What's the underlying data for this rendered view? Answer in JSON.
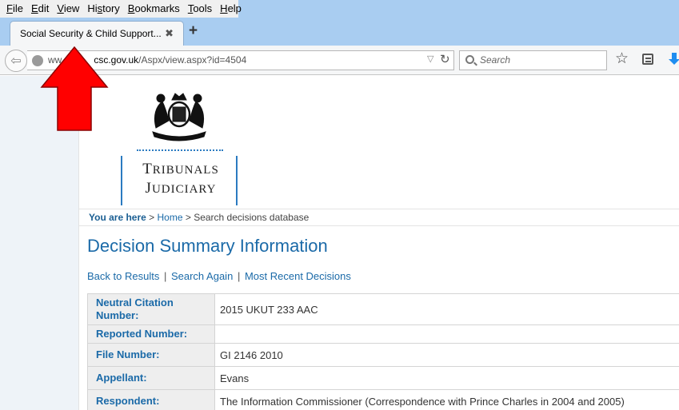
{
  "menu": {
    "items": [
      {
        "key": "F",
        "rest": "ile"
      },
      {
        "key": "E",
        "rest": "dit"
      },
      {
        "key": "V",
        "rest": "iew"
      },
      {
        "key": "",
        "pre": "Hi",
        "key2": "s",
        "post": "tory"
      },
      {
        "key": "B",
        "rest": "ookmarks"
      },
      {
        "key": "T",
        "rest": "ools"
      },
      {
        "key": "H",
        "rest": "elp"
      }
    ]
  },
  "tab": {
    "title": "Social Security & Child Support...",
    "close_glyph": "✖",
    "newtab_glyph": "+"
  },
  "navbar": {
    "url_prefix": "ww",
    "url_domain": "csc.gov.uk",
    "url_path": "/Aspx/view.aspx?id=4504",
    "search_placeholder": "Search"
  },
  "logo": {
    "line1_cap": "T",
    "line1_rest": "RIBUNALS",
    "line2_cap": "J",
    "line2_rest": "UDICIARY"
  },
  "breadcrumb": {
    "label": "You are here",
    "sep": " > ",
    "home": "Home",
    "current": "Search decisions database"
  },
  "page": {
    "heading": "Decision Summary Information",
    "links": [
      "Back to Results",
      "Search Again",
      "Most Recent Decisions"
    ],
    "link_sep": "|"
  },
  "details": [
    {
      "label": "Neutral Citation Number:",
      "value": "2015 UKUT 233 AAC"
    },
    {
      "label": "Reported Number:",
      "value": ""
    },
    {
      "label": "File Number:",
      "value": "GI 2146 2010"
    },
    {
      "label": "Appellant:",
      "value": "Evans"
    },
    {
      "label": "Respondent:",
      "value": "The Information Commissioner (Correspondence with Prince Charles in 2004 and 2005)"
    }
  ],
  "colors": {
    "chrome_blue": "#a9cdf1",
    "link_blue": "#1b6aa8",
    "annotation_red": "#ff0000"
  }
}
